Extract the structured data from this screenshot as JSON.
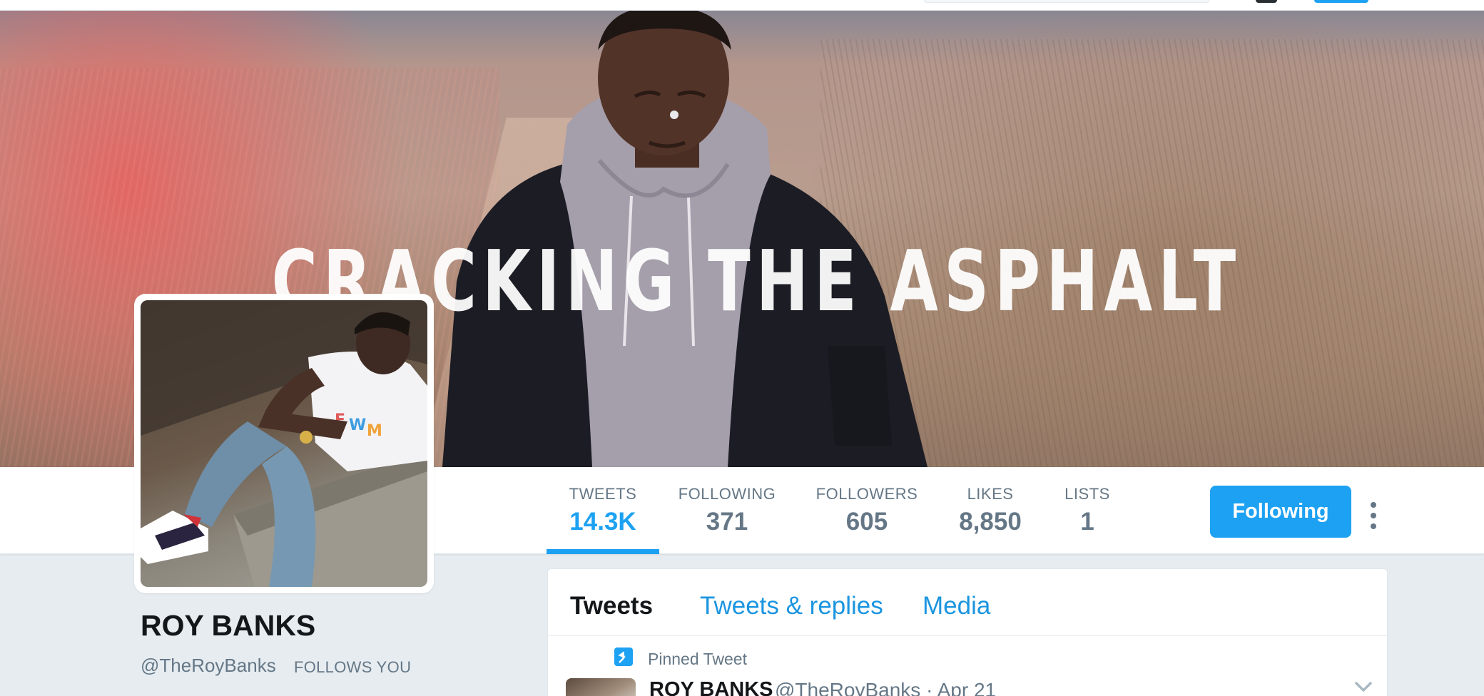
{
  "banner": {
    "title": "CRACKING THE ASPHALT"
  },
  "profile": {
    "name": "ROY BANKS",
    "handle": "@TheRoyBanks",
    "follows_you": "FOLLOWS YOU"
  },
  "stats": [
    {
      "label": "TWEETS",
      "value": "14.3K",
      "active": true
    },
    {
      "label": "FOLLOWING",
      "value": "371"
    },
    {
      "label": "FOLLOWERS",
      "value": "605"
    },
    {
      "label": "LIKES",
      "value": "8,850"
    },
    {
      "label": "LISTS",
      "value": "1"
    }
  ],
  "actions": {
    "following_label": "Following",
    "more_icon": "vertical-dots-icon"
  },
  "timeline": {
    "tabs": [
      {
        "label": "Tweets",
        "active": true
      },
      {
        "label": "Tweets & replies"
      },
      {
        "label": "Media"
      }
    ],
    "pinned_label": "Pinned Tweet",
    "pin_icon": "pin-icon",
    "tweet": {
      "name": "ROY BANKS",
      "meta": "@TheRoyBanks · Apr 21"
    }
  },
  "colors": {
    "accent": "#1da1f2",
    "link": "#1b95e0",
    "muted": "#657786",
    "background": "#e6ecf0"
  }
}
